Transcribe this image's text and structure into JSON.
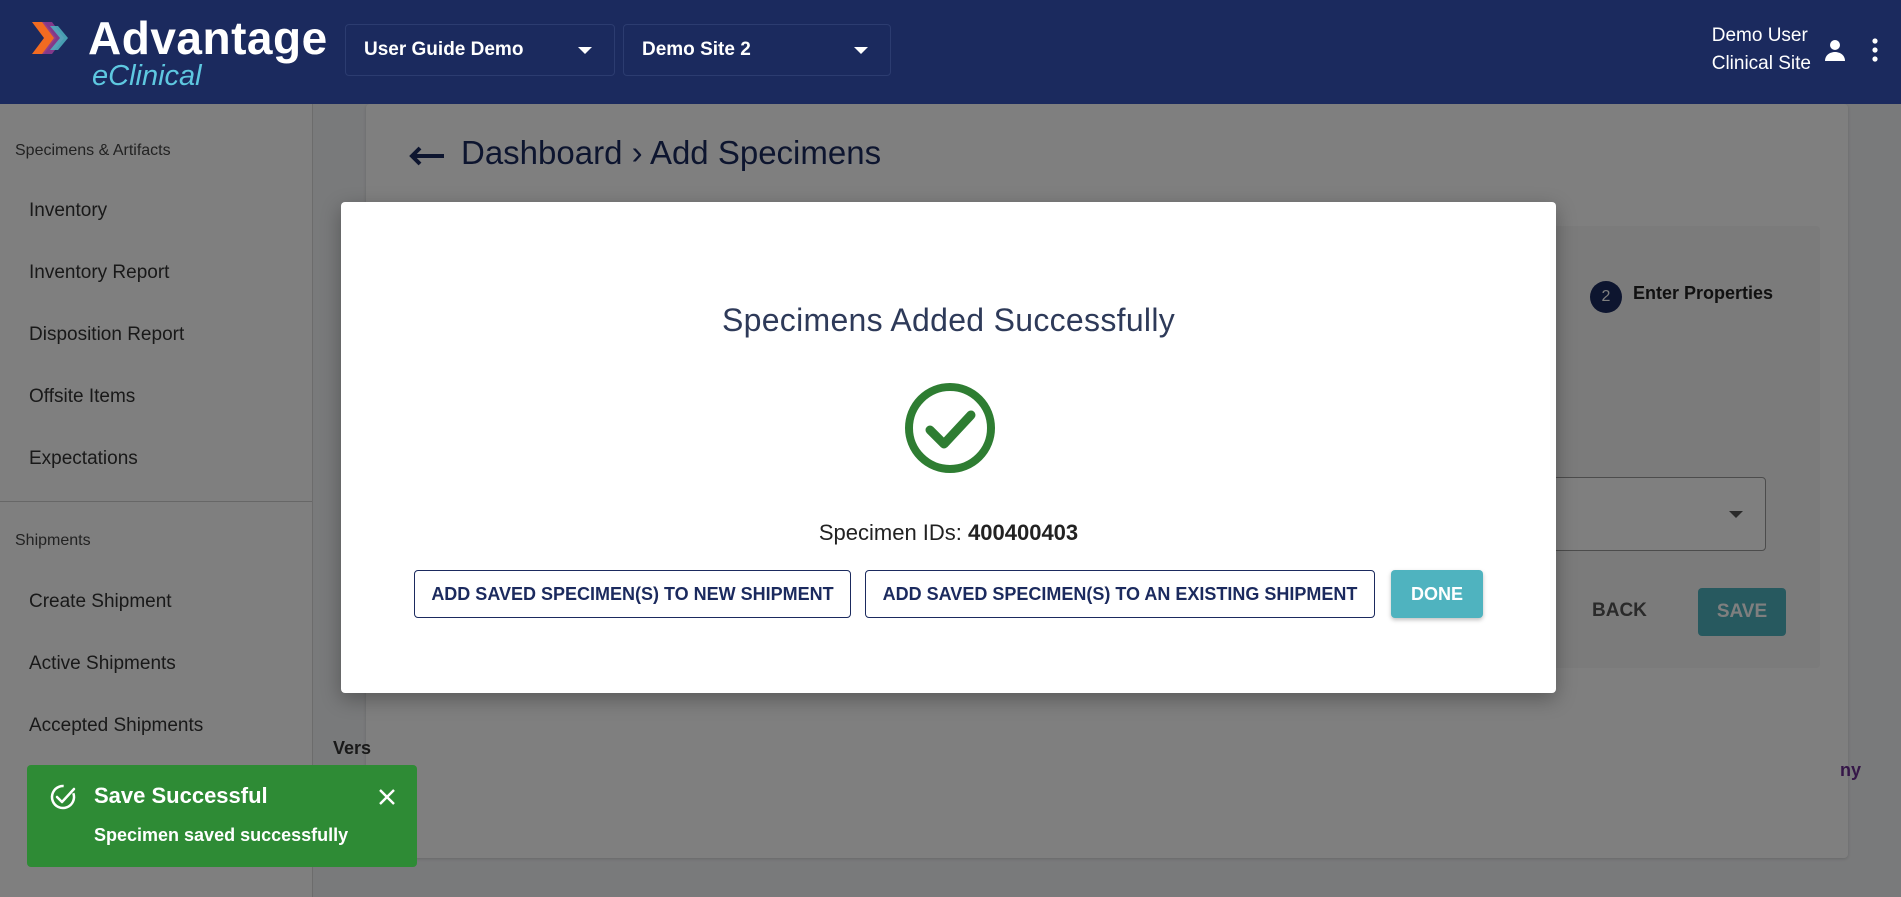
{
  "header": {
    "brand_title": "Advantage",
    "brand_subtitle": "eClinical",
    "study_select": "User Guide Demo",
    "site_select": "Demo Site 2",
    "user_name": "Demo User",
    "user_role": "Clinical Site"
  },
  "sidebar": {
    "section1": "Specimens & Artifacts",
    "section1_items": [
      "Inventory",
      "Inventory Report",
      "Disposition Report",
      "Offsite Items",
      "Expectations"
    ],
    "section2": "Shipments",
    "section2_items": [
      "Create Shipment",
      "Active Shipments",
      "Accepted Shipments"
    ]
  },
  "main": {
    "breadcrumb": "Dashboard › Add Specimens",
    "step_number": "2",
    "step_label": "Enter Properties",
    "back_label": "BACK",
    "save_label": "SAVE",
    "version_text": "Vers",
    "footer_link": "ny"
  },
  "modal": {
    "title": "Specimens Added Successfully",
    "ids_label": "Specimen IDs:",
    "ids_value": "400400403",
    "btn_new_shipment": "ADD SAVED SPECIMEN(S) TO NEW SHIPMENT",
    "btn_existing_shipment": "ADD SAVED SPECIMEN(S) TO AN EXISTING SHIPMENT",
    "btn_done": "DONE"
  },
  "toast": {
    "title": "Save Successful",
    "message": "Specimen saved successfully"
  },
  "colors": {
    "header_bg": "#1b2a5e",
    "accent_teal": "#4fb3bf",
    "success_green": "#2e8b35",
    "check_green": "#2e7d32"
  },
  "icons": [
    "brand-chevron-icon",
    "caret-down-icon",
    "user-icon",
    "more-vert-icon",
    "arrow-left-icon",
    "check-circle-icon",
    "close-icon"
  ]
}
